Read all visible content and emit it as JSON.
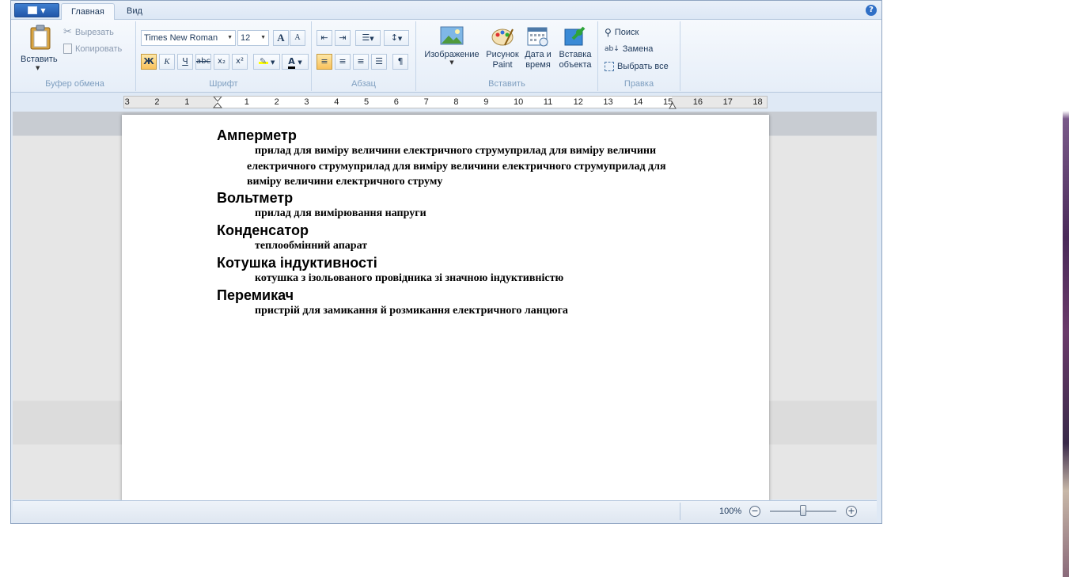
{
  "tabs": {
    "home": "Главная",
    "view": "Вид"
  },
  "help_icon": "?",
  "ribbon": {
    "clipboard": {
      "label": "Буфер обмена",
      "paste": "Вставить",
      "cut": "Вырезать",
      "copy": "Копировать"
    },
    "font": {
      "label": "Шрифт",
      "font_name": "Times New Roman",
      "font_size": "12",
      "grow": "A",
      "shrink": "A",
      "bold": "Ж",
      "italic": "К",
      "underline": "Ч",
      "strike": "abc",
      "subscript": "x₂",
      "superscript": "x²",
      "font_color": "A"
    },
    "paragraph": {
      "label": "Абзац"
    },
    "insert": {
      "label": "Вставить",
      "image": "Изображение",
      "paint_line1": "Рисунок",
      "paint_line2": "Paint",
      "datetime_line1": "Дата и",
      "datetime_line2": "время",
      "object_line1": "Вставка",
      "object_line2": "объекта"
    },
    "editing": {
      "label": "Правка",
      "find": "Поиск",
      "replace": "Замена",
      "select_all": "Выбрать все"
    }
  },
  "ruler": [
    "3",
    "2",
    "1",
    "1",
    "2",
    "3",
    "4",
    "5",
    "6",
    "7",
    "8",
    "9",
    "10",
    "11",
    "12",
    "13",
    "14",
    "15",
    "16",
    "17",
    "18"
  ],
  "document": {
    "entries": [
      {
        "term": "Амперметр",
        "definition": "прилад для виміру величини електричного струмуприлад для виміру величини електричного струмуприлад для виміру величини електричного струмуприлад для виміру величини електричного струму"
      },
      {
        "term": "Вольтметр",
        "definition": "прилад для вимірювання напруги"
      },
      {
        "term": "Конденсатор",
        "definition": "теплообмінний апарат"
      },
      {
        "term": "Котушка індуктивності",
        "definition": "котушка з ізольованого провідника зі значною індуктивністю"
      },
      {
        "term": "Перемикач",
        "definition": "пристрій для замикання й розмикання електричного ланцюга"
      }
    ]
  },
  "status": {
    "zoom": "100%",
    "zoom_level_percent": 100,
    "zoom_out": "−",
    "zoom_in": "+"
  }
}
